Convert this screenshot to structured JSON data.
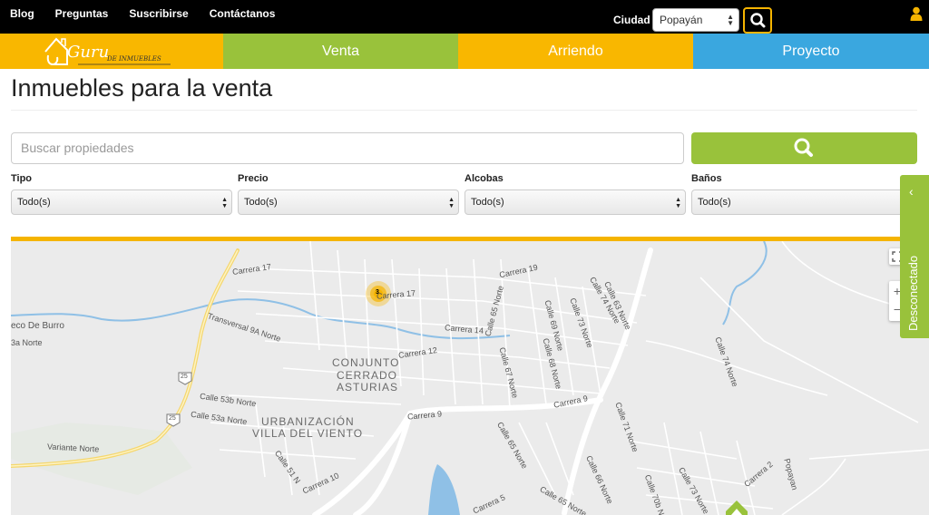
{
  "topbar": {
    "links": [
      "Blog",
      "Preguntas",
      "Suscribirse",
      "Contáctanos"
    ],
    "city_label": "Ciudad",
    "city_value": "Popayán"
  },
  "navbar": {
    "logo_text": "Guru",
    "logo_sub": "DE INMUEBLES",
    "tabs": [
      "Venta",
      "Arriendo",
      "Proyecto"
    ]
  },
  "page": {
    "title": "Inmuebles para la venta",
    "search_placeholder": "Buscar propiedades"
  },
  "filters": [
    {
      "label": "Tipo",
      "value": "Todo(s)"
    },
    {
      "label": "Precio",
      "value": "Todo(s)"
    },
    {
      "label": "Alcobas",
      "value": "Todo(s)"
    },
    {
      "label": "Baños",
      "value": "Todo(s)"
    }
  ],
  "side_panel": {
    "label": "Desconectado"
  },
  "map": {
    "cluster_count": "3",
    "labels": [
      "Carrera 17",
      "Carrera 19",
      "Carrera 17",
      "Carrera 14",
      "Carrera 12",
      "Carrera 9",
      "Carrera 9",
      "Transversal 9A Norte",
      "Calle 53b Norte",
      "Calle 53a Norte",
      "Variante Norte",
      "Calle 51 N",
      "Carrera 10",
      "Calle 65 Norte",
      "Calle 67 Norte",
      "Calle 68 Norte",
      "Calle 69 Norte",
      "Calle 73 Norte",
      "Calle 74 Norte",
      "Calle 71 Norte",
      "Calle 74 Norte",
      "Calle 65 Norte",
      "Calle 70b N",
      "Calle 73 Norte",
      "Carrera 2",
      "Popayan",
      "Carrera 5",
      "Calle 65 Norte",
      "Calle 66 Norte",
      "Calle 63 Norte",
      "CONJUNTO",
      "CERRADO",
      "ASTURIAS",
      "URBANIZACIÓN",
      "VILLA DEL VIENTO",
      "eco De Burro",
      "3a Norte",
      "25",
      "25"
    ]
  },
  "colors": {
    "yellow": "#f9b700",
    "green": "#99c23b",
    "blue": "#3aa7df",
    "black": "#000000"
  }
}
